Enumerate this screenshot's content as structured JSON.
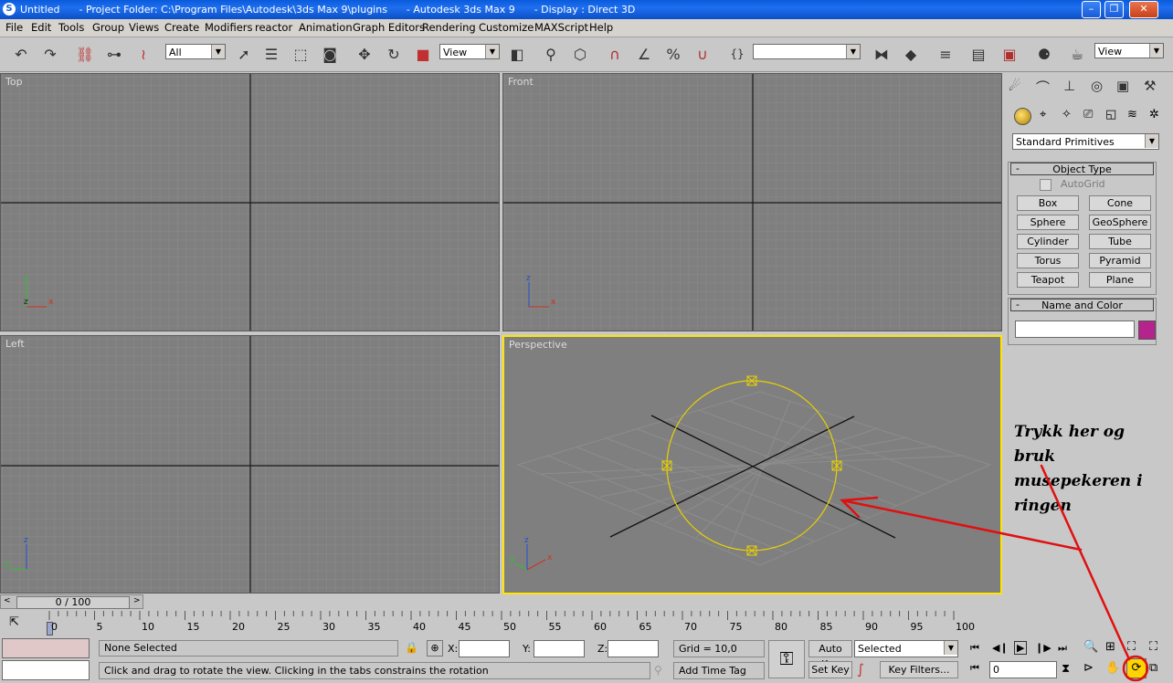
{
  "titlebar": {
    "title": "Untitled      - Project Folder: C:\\Program Files\\Autodesk\\3ds Max 9\\plugins      - Autodesk 3ds Max 9      - Display : Direct 3D"
  },
  "menu": [
    "File",
    "Edit",
    "Tools",
    "Group",
    "Views",
    "Create",
    "Modifiers",
    "reactor",
    "Animation",
    "Graph Editors",
    "Rendering",
    "Customize",
    "MAXScript",
    "Help"
  ],
  "toolbar": {
    "selection_filter": "All",
    "ref_coord": "View",
    "named_selection": "",
    "render_view": "View"
  },
  "viewports": {
    "top": "Top",
    "front": "Front",
    "left": "Left",
    "perspective": "Perspective"
  },
  "command_panel": {
    "category": "Standard Primitives",
    "object_type_header": "Object Type",
    "autogrid": "AutoGrid",
    "buttons": [
      "Box",
      "Cone",
      "Sphere",
      "GeoSphere",
      "Cylinder",
      "Tube",
      "Torus",
      "Pyramid",
      "Teapot",
      "Plane"
    ],
    "name_color_header": "Name and Color",
    "name_value": "",
    "object_color": "#b5238c"
  },
  "timeline": {
    "frame_display": "0 / 100",
    "ticks": [
      "0",
      "5",
      "10",
      "15",
      "20",
      "25",
      "30",
      "35",
      "40",
      "45",
      "50",
      "55",
      "60",
      "65",
      "70",
      "75",
      "80",
      "85",
      "90",
      "95",
      "100"
    ]
  },
  "status": {
    "selection": "None Selected",
    "x_label": "X:",
    "y_label": "Y:",
    "z_label": "Z:",
    "grid": "Grid = 10,0",
    "prompt": "Click and drag to rotate the view.  Clicking in the tabs constrains the rotation",
    "add_time_tag": "Add Time Tag",
    "auto_key": "Auto Key",
    "set_key": "Set Key",
    "key_mode": "Selected",
    "key_filters": "Key Filters...",
    "current_frame": "0"
  },
  "annotation": {
    "lines": [
      "Trykk her og",
      "bruk",
      "musepekeren i",
      "ringen"
    ],
    "color": "#e01010"
  }
}
